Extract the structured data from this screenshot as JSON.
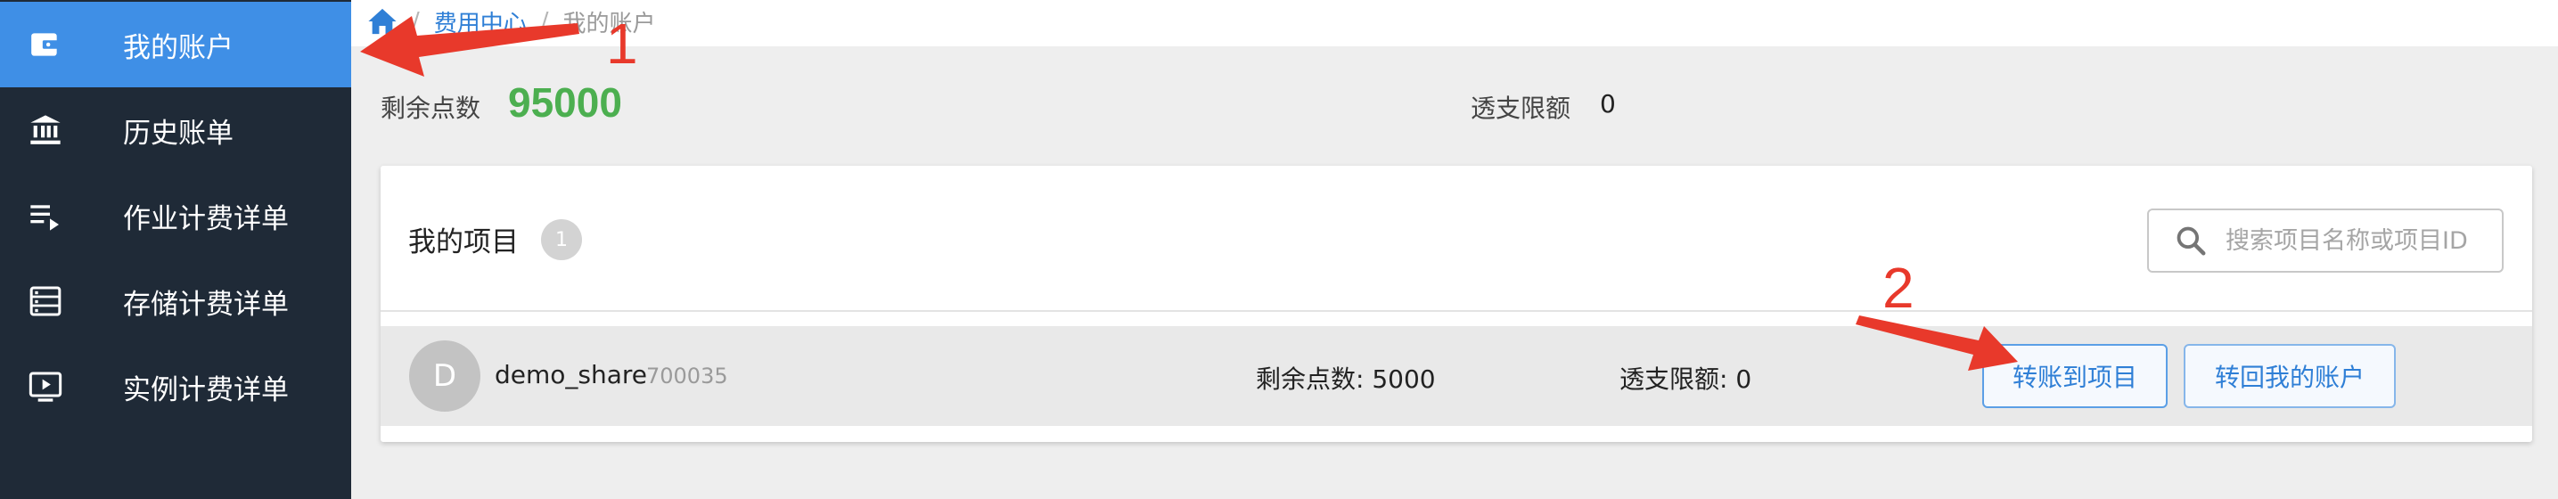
{
  "sidebar": {
    "items": [
      {
        "label": "我的账户",
        "icon": "wallet-icon",
        "active": true
      },
      {
        "label": "历史账单",
        "icon": "bank-icon",
        "active": false
      },
      {
        "label": "作业计费详单",
        "icon": "playlist-icon",
        "active": false
      },
      {
        "label": "存储计费详单",
        "icon": "storage-list-icon",
        "active": false
      },
      {
        "label": "实例计费详单",
        "icon": "monitor-play-icon",
        "active": false
      }
    ],
    "bg_color": "#1f2a37",
    "active_color": "#3f8fe6"
  },
  "breadcrumb": {
    "home_icon": "home-icon",
    "separator": "/",
    "parent": "费用中心",
    "current": "我的账户"
  },
  "account": {
    "balance_label": "剩余点数",
    "balance_value": "95000",
    "overdraft_label": "透支限额",
    "overdraft_value": "0",
    "balance_color": "#4caf50"
  },
  "projects": {
    "title": "我的项目",
    "count": "1",
    "search_placeholder": "搜索项目名称或项目ID",
    "search_icon": "search-icon",
    "rows": [
      {
        "avatar": "D",
        "name": "demo_share",
        "id": "700035",
        "balance": "剩余点数: 5000",
        "overdraft": "透支限额: 0",
        "transfer_label": "转账到项目",
        "return_label": "转回我的账户"
      }
    ]
  },
  "annotations": {
    "marker_1": "1",
    "marker_2": "2",
    "color": "#e8392b"
  }
}
